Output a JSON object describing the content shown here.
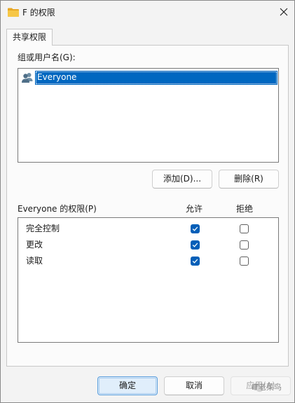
{
  "window": {
    "title": "F 的权限",
    "close_icon": "close-icon",
    "folder_icon": "folder-icon",
    "folder_color": "#f4c24a"
  },
  "tab": {
    "label": "共享权限"
  },
  "users_section": {
    "label": "组或用户名(G):",
    "items": [
      {
        "name": "Everyone",
        "icon": "users-icon",
        "selected": true
      }
    ],
    "add_label": "添加(D)...",
    "remove_label": "删除(R)"
  },
  "permissions": {
    "label": "Everyone 的权限(P)",
    "allow_header": "允许",
    "deny_header": "拒绝",
    "rows": [
      {
        "name": "完全控制",
        "allow": true,
        "deny": false
      },
      {
        "name": "更改",
        "allow": true,
        "deny": false
      },
      {
        "name": "读取",
        "allow": true,
        "deny": false
      }
    ]
  },
  "footer": {
    "ok_label": "确定",
    "cancel_label": "取消",
    "apply_label": "应用(A)"
  },
  "watermark": {
    "text": "IT老菜鸟"
  },
  "colors": {
    "accent": "#005fb8",
    "selection": "#0067c0"
  }
}
